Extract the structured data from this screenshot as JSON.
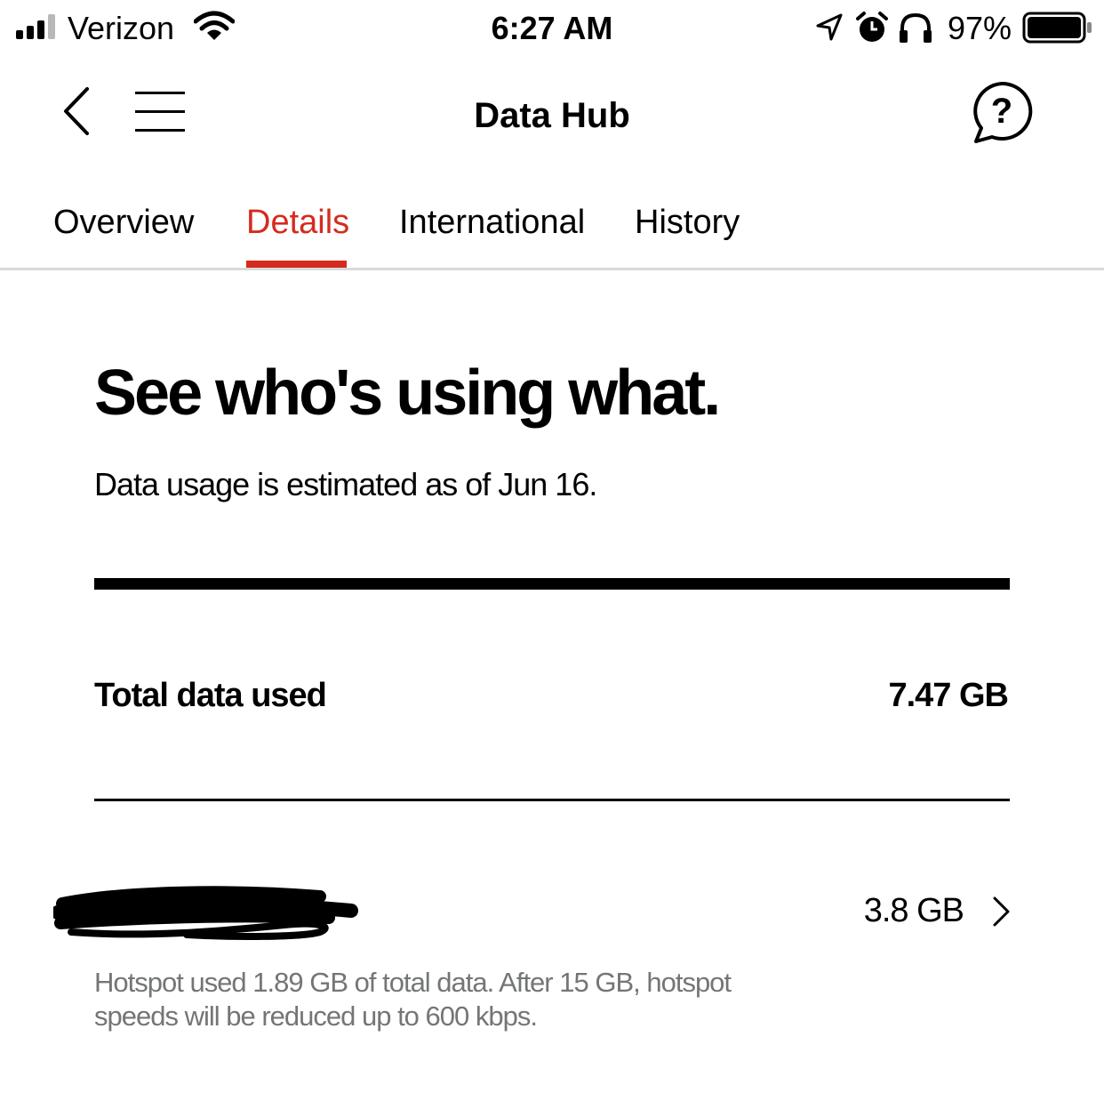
{
  "status_bar": {
    "carrier": "Verizon",
    "time": "6:27 AM",
    "battery_percent": "97%",
    "icons": [
      "signal-icon",
      "wifi-icon",
      "location-arrow-icon",
      "alarm-icon",
      "headphones-icon",
      "battery-icon"
    ]
  },
  "nav": {
    "title": "Data Hub",
    "icons": [
      "back-chevron-icon",
      "hamburger-menu-icon",
      "help-chat-icon"
    ]
  },
  "tabs": [
    {
      "label": "Overview",
      "active": false
    },
    {
      "label": "Details",
      "active": true
    },
    {
      "label": "International",
      "active": false
    },
    {
      "label": "History",
      "active": false
    }
  ],
  "main": {
    "headline": "See who's using what.",
    "subtext": "Data usage is estimated as of Jun 16.",
    "total_label": "Total data used",
    "total_value": "7.47 GB",
    "lines": [
      {
        "value": "3.8 GB",
        "note": "Hotspot used 1.89 GB of total data. After 15 GB, hotspot speeds will be reduced up to 600 kbps."
      }
    ]
  },
  "colors": {
    "accent": "#d52b1e",
    "text": "#000000",
    "muted": "#747676",
    "divider": "#d8dada"
  }
}
